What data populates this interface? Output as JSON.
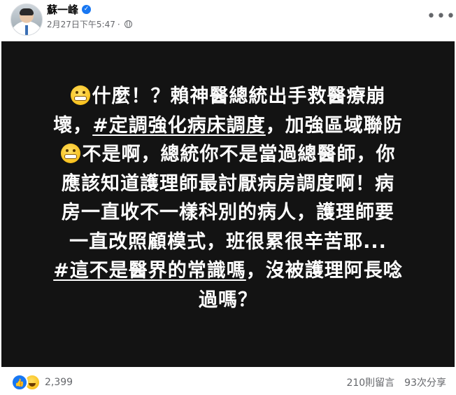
{
  "author": {
    "name": "蘇一峰",
    "verified_icon": "verified-badge-icon"
  },
  "meta": {
    "timestamp": "2月27日下午5:47",
    "separator": "·",
    "audience_icon": "globe-icon"
  },
  "post": {
    "background": "#131313",
    "lines": {
      "l1": "什麼！？賴神醫總統出手救醫療崩",
      "l2a": "壞，",
      "l2tag": "#定調強化病床調度",
      "l2b": "，加強區域聯防",
      "l3": "不是啊，總統你不是當過總醫師，你",
      "l4": "應該知道護理師最討厭病房調度啊！病",
      "l5": "房一直收不一樣科別的病人，護理師要",
      "l6": "一直改照顧模式，班很累很辛苦耶...",
      "l7tag": "#這不是醫界的常識嗎",
      "l7b": "，沒被護理阿長唸",
      "l8": "過嗎？"
    },
    "emoji_icon": "grimacing-face-icon"
  },
  "footer": {
    "reactions": [
      "like-icon",
      "haha-icon"
    ],
    "reaction_count": "2,399",
    "comments": "210則留言",
    "shares": "93次分享"
  },
  "colors": {
    "accent": "#1877f2",
    "muted_text": "#65676b"
  }
}
